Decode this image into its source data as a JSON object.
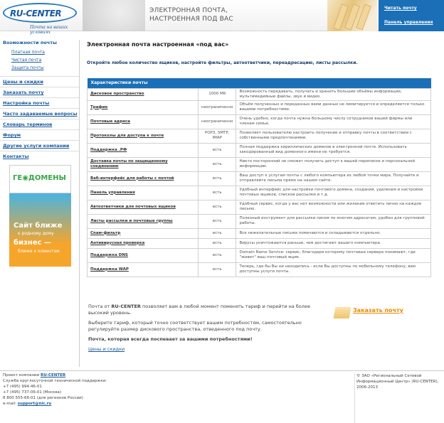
{
  "header": {
    "logo_text": "RU-CENTER",
    "logo_slogan": "Почта на ваших условиях",
    "tagline_1": "ЭЛЕКТРОННАЯ ПОЧТА,",
    "tagline_2": "НАСТРОЕННАЯ ПОД ВАС",
    "links": [
      "Читать почту",
      "Панель управления"
    ]
  },
  "sidebar": {
    "title": "Возможности почты",
    "subs": [
      "Платная почта",
      "Чистая почта",
      "Защита почты"
    ],
    "items": [
      "Цены и скидки",
      "Заказать почту",
      "Настройка почты",
      "Часто задаваемые вопросы",
      "Словарь терминов",
      "Форум",
      "Другие услуги компании",
      "Контакты"
    ],
    "banner": {
      "brand": "ГЕ◉ДОМЕНЫ",
      "l1": "Сайт ближе",
      "l2": "к родному дому",
      "l3": "бизнес —",
      "l4": "ближе к клиентам"
    }
  },
  "main": {
    "title": "Электронная почта настроенная «под вас»",
    "intro": "Откройте любое количество ящиков, настройте фильтры, автоответчики, переадресацию, листы рассылки."
  },
  "table": {
    "header": "Характеристики почты",
    "rows": [
      {
        "name": "Дисковое пространство",
        "value": "1000 Мб",
        "desc": "Возможность передавать, получать и хранить большие объёмы информации, мультимедийные файлы, звук и видео."
      },
      {
        "name": "Трафик",
        "value": "неограниченно",
        "desc": "Объём полученных и переданных вами данных не лимитируется и определяется только вашими потребностями."
      },
      {
        "name": "Почтовые адреса",
        "value": "неограниченно",
        "desc": "Очень удобно, когда почта нужна большому числу сотрудников вашей фирмы или членам семьи."
      },
      {
        "name": "Протоколы для доступа к почте",
        "value": "POP3, SMTP, IMAP",
        "desc": "Позволяет пользователю настроить получение и отправку почты в соответствии с собственными предпочтениями."
      },
      {
        "name": "Поддержка .РФ",
        "value": "есть",
        "desc": "Полная поддержка кириллических доменов в электронной почте. Использовать закодированный вид доменного имени не требуется."
      },
      {
        "name": "Доставка почты по защищенному соединению",
        "value": "есть",
        "desc": "Никто посторонний не сможет получить доступ к вашей переписке и персональной информации."
      },
      {
        "name": "Веб-интерфейс для работы с почтой",
        "value": "есть",
        "desc": "Ваш доступ к услугам почты с любого компьютера из любой точки мира. Получайте и отправляйте письма прямо на нашем сайте."
      },
      {
        "name": "Панель управления",
        "value": "есть",
        "desc": "Удобный интерфейс для настройки почтового домена, создания, удаления и настройки почтовых ящиков, списков рассылки и т.д."
      },
      {
        "name": "Автоответчики для почтовых ящиков",
        "value": "есть",
        "desc": "Удобный сервис, когда у вас нет возможности или желания ответить лично на каждое письмо."
      },
      {
        "name": "Листы рассылки и почтовые группы",
        "value": "есть",
        "desc": "Полезный инструмент для рассылки писем по многим адресатам, удобен для групповой работы."
      },
      {
        "name": "Спам-фильтр",
        "value": "есть",
        "desc": "Все нежелательные письма помечаются и складываются отдельно."
      },
      {
        "name": "Антивирусная проверка",
        "value": "есть",
        "desc": "Вирусы уничтожаются раньше, чем достигают вашего компьютера."
      },
      {
        "name": "Поддержка DNS",
        "value": "есть",
        "desc": "Domain Name Service: сервис, благодаря которому почтовые сервера понимают, где \"живет\" ваш почтовый ящик."
      },
      {
        "name": "Поддержка WAP",
        "value": "есть",
        "desc": "Теперь, где бы Вы ни находились - если Вы доступны по мобильному телефону, вам доступны услуги почты."
      }
    ]
  },
  "foot": {
    "p1a": "Почта от ",
    "p1b": "RU-CENTER",
    "p1c": " позволяет вам в любой момент поменять тариф и перейти на более высокий уровень.",
    "p2": "Выберите тариф, который точно соответствует вашим потребностям, самостоятельно регулируйте размер дискового пространства, отведенного под почту.",
    "p3": "Почта, которая всегда поспевает за вашими потребностями!",
    "link": "Цены и скидки",
    "order": "Заказать почту"
  },
  "footer": {
    "l1a": "Проект компании ",
    "l1b": "RU-CENTER",
    "l2": "Служба круглосуточной технической поддержки:",
    "l3": "+7 (495) 994-46-01",
    "l4": "+7 (495) 737-06-01 (Москва)",
    "l5": "8 800 555-66-01 (для регионов России)",
    "l6a": "e-mail: ",
    "l6b": "support@nic.ru",
    "r1": "© ЗАО «Региональный Сетевой Информационный Центр» (RU-CENTER), 2006-2013"
  }
}
